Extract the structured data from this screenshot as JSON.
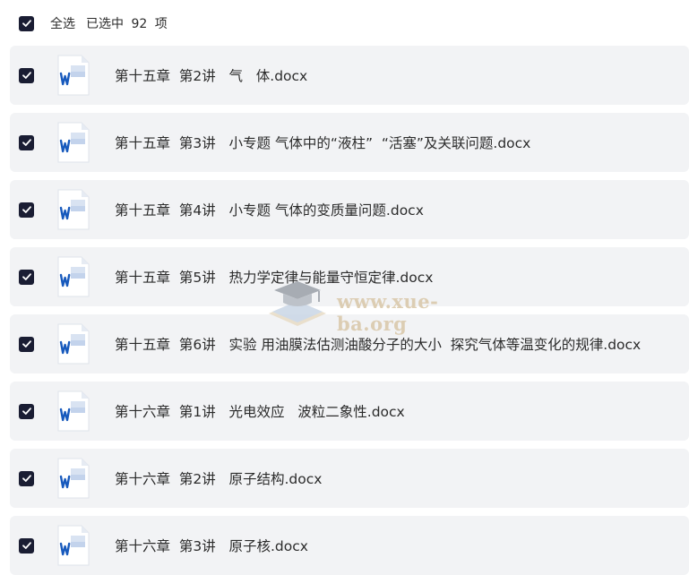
{
  "header": {
    "select_all_label": "全选",
    "selected_text": "已选中 92 项"
  },
  "files": [
    {
      "name": "第十五章  第2讲   气   体.docx",
      "checked": true
    },
    {
      "name": "第十五章  第3讲   小专题 气体中的“液柱”  “活塞”及关联问题.docx",
      "checked": true
    },
    {
      "name": "第十五章  第4讲   小专题 气体的变质量问题.docx",
      "checked": true
    },
    {
      "name": "第十五章  第5讲   热力学定律与能量守恒定律.docx",
      "checked": true
    },
    {
      "name": "第十五章  第6讲   实验 用油膜法估测油酸分子的大小  探究气体等温变化的规律.docx",
      "checked": true
    },
    {
      "name": "第十六章  第1讲   光电效应   波粒二象性.docx",
      "checked": true
    },
    {
      "name": "第十六章  第2讲   原子结构.docx",
      "checked": true
    },
    {
      "name": "第十六章  第3讲   原子核.docx",
      "checked": true
    }
  ],
  "icons": {
    "checkbox": "check-icon",
    "file": "word-doc-icon"
  },
  "colors": {
    "checkbox_fill": "#1a1d33",
    "row_background": "#f2f3f5",
    "word_blue": "#185abd"
  },
  "watermark": {
    "text": "www.xue-ba.org"
  }
}
